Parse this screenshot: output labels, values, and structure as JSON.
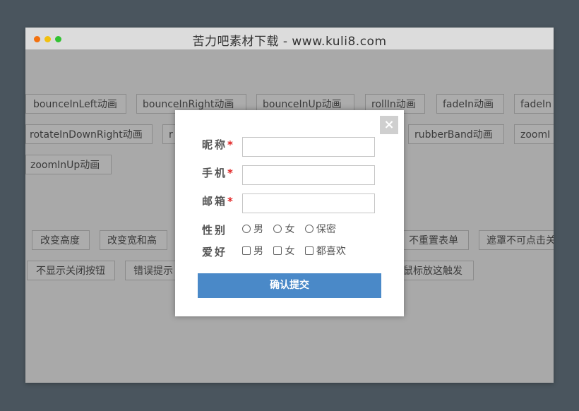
{
  "window": {
    "title": "苦力吧素材下载 - www.kuli8.com"
  },
  "anim_buttons_row1": [
    "bounceInLeft动画",
    "bounceInRight动画",
    "bounceInUp动画",
    "rollIn动画",
    "fadeIn动画",
    "fadeIn"
  ],
  "anim_buttons_row2": [
    "rotateInDownRight动画",
    "r",
    "rubberBand动画",
    "zoomI"
  ],
  "anim_buttons_row3": [
    "zoomInUp动画"
  ],
  "option_buttons_row1": [
    "改变高度",
    "改变宽和高",
    "不重置表单",
    "遮罩不可点击关"
  ],
  "option_buttons_row2": [
    "不显示关闭按钮",
    "错误提示",
    "鼠标放这触发"
  ],
  "modal": {
    "close_label": "×",
    "nickname_label": "昵称",
    "phone_label": "手机",
    "email_label": "邮箱",
    "required_mark": "*",
    "gender_label": "性别",
    "gender_options": [
      "男",
      "女",
      "保密"
    ],
    "hobby_label": "爱好",
    "hobby_options": [
      "男",
      "女",
      "都喜欢"
    ],
    "submit_label": "确认提交"
  }
}
